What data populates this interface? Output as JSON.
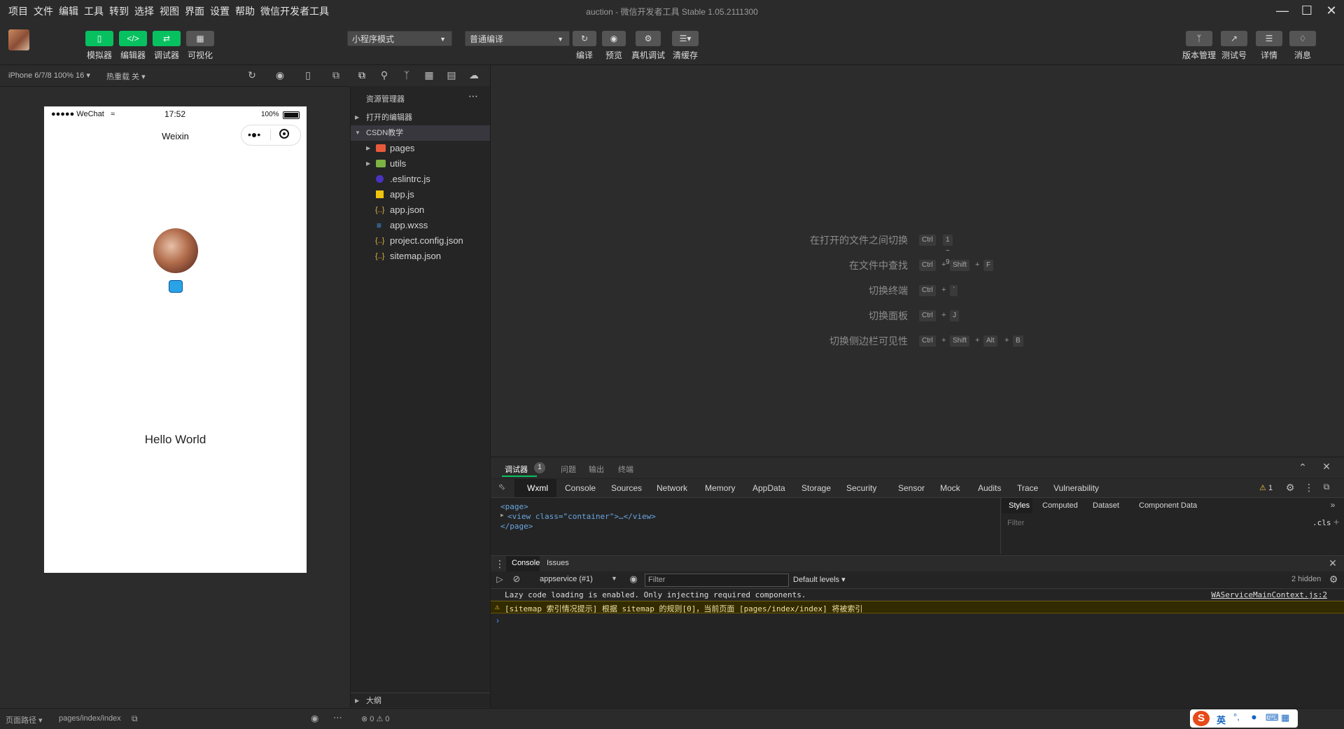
{
  "menu": {
    "items": [
      "项目",
      "文件",
      "编辑",
      "工具",
      "转到",
      "选择",
      "视图",
      "界面",
      "设置",
      "帮助",
      "微信开发者工具"
    ],
    "title": "auction - 微信开发者工具 Stable 1.05.2111300"
  },
  "toolbar": {
    "simulator_label": "模拟器",
    "editor_label": "编辑器",
    "debugger_label": "调试器",
    "visual_label": "可视化",
    "mode_select": "小程序模式",
    "compile_select": "普通编译",
    "compile_label": "编译",
    "preview_label": "预览",
    "remote_debug_label": "真机调试",
    "clear_cache_label": "清缓存",
    "version_label": "版本管理",
    "test_label": "测试号",
    "details_label": "详情",
    "messages_label": "消息"
  },
  "simulator": {
    "device": "iPhone 6/7/8 100% 16",
    "hot_reload": "热重载 关",
    "status_carrier": "●●●●● WeChat",
    "status_time": "17:52",
    "status_battery": "100%",
    "nav_title": "Weixin",
    "hello": "Hello World"
  },
  "explorer": {
    "header": "资源管理器",
    "open_editors": "打开的编辑器",
    "project": "CSDN教学",
    "files": [
      "pages",
      "utils",
      ".eslintrc.js",
      "app.js",
      "app.json",
      "app.wxss",
      "project.config.json",
      "sitemap.json"
    ],
    "outline": "大纲",
    "status": "⊗ 0 ⚠ 0"
  },
  "shortcuts": [
    {
      "label": "在打开的文件之间切换",
      "keys": [
        "Ctrl",
        "1 ~ 9"
      ]
    },
    {
      "label": "在文件中查找",
      "keys": [
        "Ctrl",
        "Shift",
        "F"
      ]
    },
    {
      "label": "切换终端",
      "keys": [
        "Ctrl",
        "`"
      ]
    },
    {
      "label": "切换面板",
      "keys": [
        "Ctrl",
        "J"
      ]
    },
    {
      "label": "切换侧边栏可见性",
      "keys": [
        "Ctrl",
        "Shift",
        "Alt",
        "B"
      ]
    }
  ],
  "debugger": {
    "top_tabs": [
      "调试器",
      "问题",
      "输出",
      "终端"
    ],
    "badge": "1",
    "devtools_tabs": [
      "Wxml",
      "Console",
      "Sources",
      "Network",
      "Memory",
      "AppData",
      "Storage",
      "Security",
      "Sensor",
      "Mock",
      "Audits",
      "Trace",
      "Vulnerability"
    ],
    "warn_count": "1",
    "wxml_lines": [
      "<page>",
      "<view class=\"container\">…</view>",
      "</page>"
    ],
    "styles_tabs": [
      "Styles",
      "Computed",
      "Dataset",
      "Component Data"
    ],
    "filter_placeholder": "Filter",
    "cls": ".cls",
    "console_tabs": [
      "Console",
      "Issues"
    ],
    "context": "appservice (#1)",
    "console_filter": "Filter",
    "levels": "Default levels",
    "hidden": "2 hidden",
    "log1": "Lazy code loading is enabled. Only injecting required components.",
    "log1_source": "WAServiceMainContext.js:2",
    "log2": "[sitemap 索引情况提示] 根据 sitemap 的规则[0]，当前页面 [pages/index/index] 将被索引"
  },
  "statusbar": {
    "path_label": "页面路径",
    "path_value": "pages/index/index"
  },
  "ime": {
    "lang": "英"
  }
}
